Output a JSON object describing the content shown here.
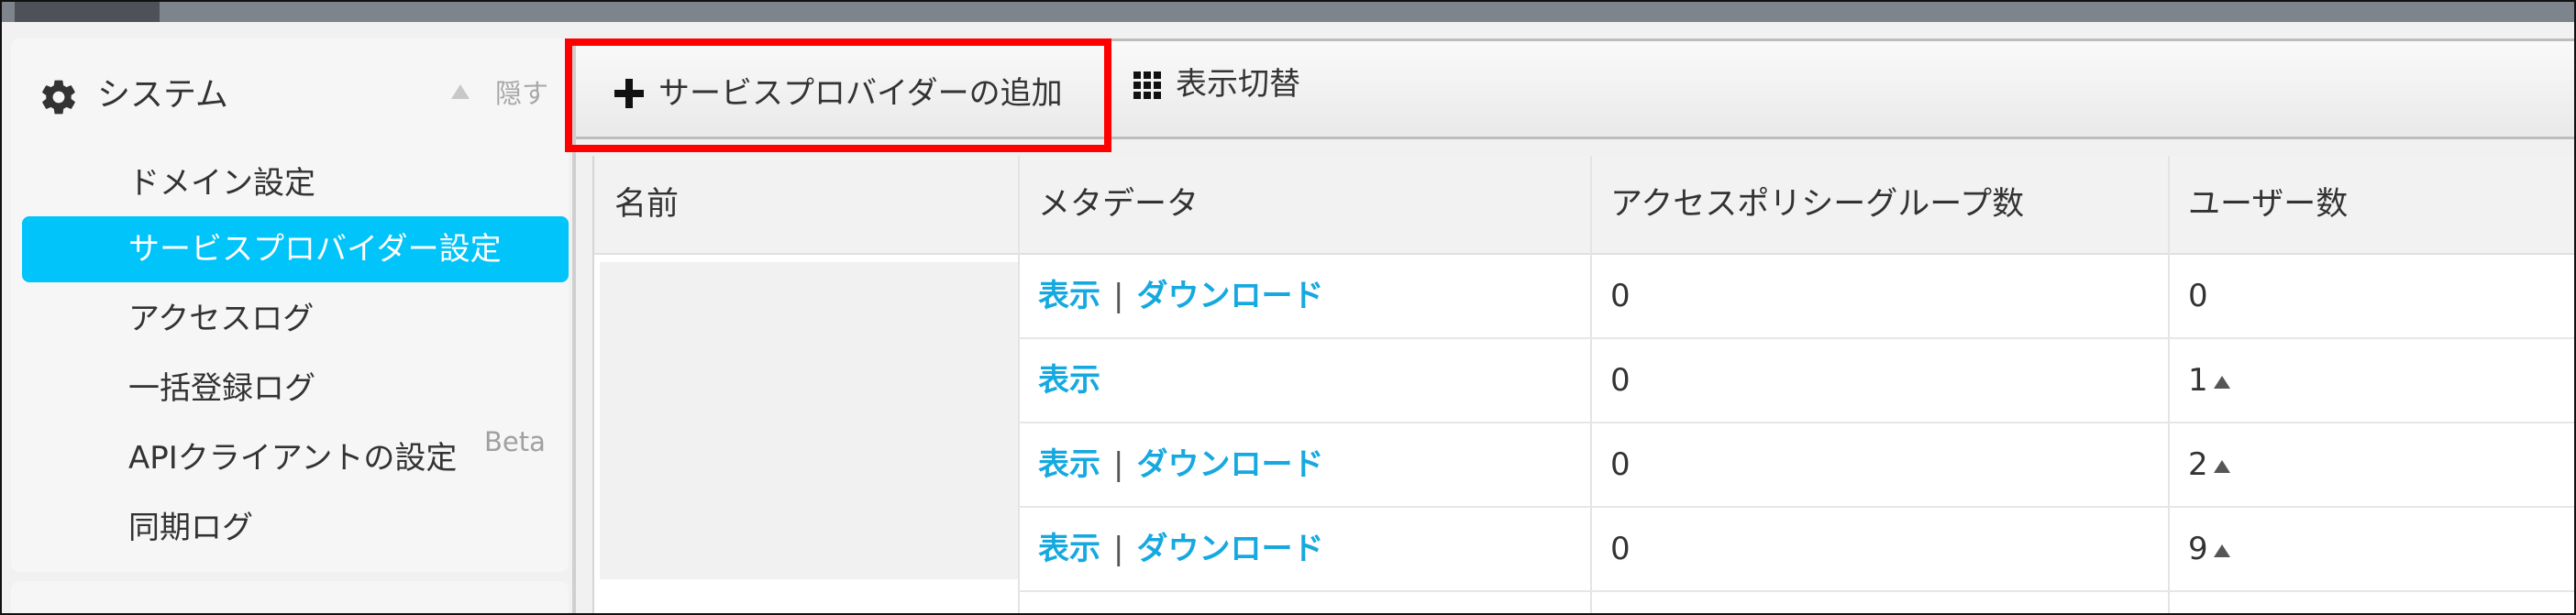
{
  "sidebar": {
    "title": "システム",
    "hide_label": "隠す",
    "items": [
      {
        "label": "ドメイン設定"
      },
      {
        "label": "サービスプロバイダー設定"
      },
      {
        "label": "アクセスログ"
      },
      {
        "label": "一括登録ログ"
      },
      {
        "label": "APIクライアントの設定",
        "badge": "Beta"
      },
      {
        "label": "同期ログ"
      }
    ]
  },
  "toolbar": {
    "add_service_provider_label": "サービスプロバイダーの追加",
    "toggle_view_label": "表示切替"
  },
  "table": {
    "headers": [
      "名前",
      "メタデータ",
      "アクセスポリシーグループ数",
      "ユーザー数"
    ],
    "rows": [
      {
        "view": "表示",
        "separator": "|",
        "download": "ダウンロード",
        "groups": "0",
        "users": "0"
      },
      {
        "view": "表示",
        "groups": "0",
        "users": "1"
      },
      {
        "view": "表示",
        "separator": "|",
        "download": "ダウンロード",
        "groups": "0",
        "users": "2"
      },
      {
        "view": "表示",
        "separator": "|",
        "download": "ダウンロード",
        "groups": "0",
        "users": "9"
      }
    ]
  },
  "colors": {
    "accent": "#00c4fa",
    "link": "#16a9e0",
    "highlight_border": "#ff0000"
  }
}
